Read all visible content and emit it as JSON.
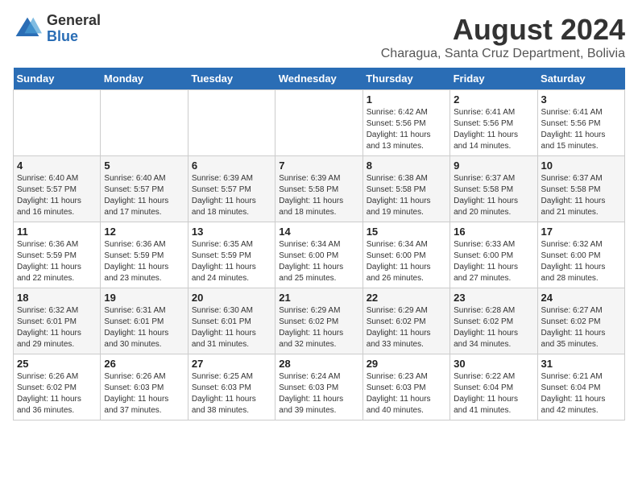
{
  "logo": {
    "general": "General",
    "blue": "Blue"
  },
  "title": "August 2024",
  "subtitle": "Charagua, Santa Cruz Department, Bolivia",
  "days_of_week": [
    "Sunday",
    "Monday",
    "Tuesday",
    "Wednesday",
    "Thursday",
    "Friday",
    "Saturday"
  ],
  "weeks": [
    [
      {
        "day": "",
        "info": ""
      },
      {
        "day": "",
        "info": ""
      },
      {
        "day": "",
        "info": ""
      },
      {
        "day": "",
        "info": ""
      },
      {
        "day": "1",
        "info": "Sunrise: 6:42 AM\nSunset: 5:56 PM\nDaylight: 11 hours\nand 13 minutes."
      },
      {
        "day": "2",
        "info": "Sunrise: 6:41 AM\nSunset: 5:56 PM\nDaylight: 11 hours\nand 14 minutes."
      },
      {
        "day": "3",
        "info": "Sunrise: 6:41 AM\nSunset: 5:56 PM\nDaylight: 11 hours\nand 15 minutes."
      }
    ],
    [
      {
        "day": "4",
        "info": "Sunrise: 6:40 AM\nSunset: 5:57 PM\nDaylight: 11 hours\nand 16 minutes."
      },
      {
        "day": "5",
        "info": "Sunrise: 6:40 AM\nSunset: 5:57 PM\nDaylight: 11 hours\nand 17 minutes."
      },
      {
        "day": "6",
        "info": "Sunrise: 6:39 AM\nSunset: 5:57 PM\nDaylight: 11 hours\nand 18 minutes."
      },
      {
        "day": "7",
        "info": "Sunrise: 6:39 AM\nSunset: 5:58 PM\nDaylight: 11 hours\nand 18 minutes."
      },
      {
        "day": "8",
        "info": "Sunrise: 6:38 AM\nSunset: 5:58 PM\nDaylight: 11 hours\nand 19 minutes."
      },
      {
        "day": "9",
        "info": "Sunrise: 6:37 AM\nSunset: 5:58 PM\nDaylight: 11 hours\nand 20 minutes."
      },
      {
        "day": "10",
        "info": "Sunrise: 6:37 AM\nSunset: 5:58 PM\nDaylight: 11 hours\nand 21 minutes."
      }
    ],
    [
      {
        "day": "11",
        "info": "Sunrise: 6:36 AM\nSunset: 5:59 PM\nDaylight: 11 hours\nand 22 minutes."
      },
      {
        "day": "12",
        "info": "Sunrise: 6:36 AM\nSunset: 5:59 PM\nDaylight: 11 hours\nand 23 minutes."
      },
      {
        "day": "13",
        "info": "Sunrise: 6:35 AM\nSunset: 5:59 PM\nDaylight: 11 hours\nand 24 minutes."
      },
      {
        "day": "14",
        "info": "Sunrise: 6:34 AM\nSunset: 6:00 PM\nDaylight: 11 hours\nand 25 minutes."
      },
      {
        "day": "15",
        "info": "Sunrise: 6:34 AM\nSunset: 6:00 PM\nDaylight: 11 hours\nand 26 minutes."
      },
      {
        "day": "16",
        "info": "Sunrise: 6:33 AM\nSunset: 6:00 PM\nDaylight: 11 hours\nand 27 minutes."
      },
      {
        "day": "17",
        "info": "Sunrise: 6:32 AM\nSunset: 6:00 PM\nDaylight: 11 hours\nand 28 minutes."
      }
    ],
    [
      {
        "day": "18",
        "info": "Sunrise: 6:32 AM\nSunset: 6:01 PM\nDaylight: 11 hours\nand 29 minutes."
      },
      {
        "day": "19",
        "info": "Sunrise: 6:31 AM\nSunset: 6:01 PM\nDaylight: 11 hours\nand 30 minutes."
      },
      {
        "day": "20",
        "info": "Sunrise: 6:30 AM\nSunset: 6:01 PM\nDaylight: 11 hours\nand 31 minutes."
      },
      {
        "day": "21",
        "info": "Sunrise: 6:29 AM\nSunset: 6:02 PM\nDaylight: 11 hours\nand 32 minutes."
      },
      {
        "day": "22",
        "info": "Sunrise: 6:29 AM\nSunset: 6:02 PM\nDaylight: 11 hours\nand 33 minutes."
      },
      {
        "day": "23",
        "info": "Sunrise: 6:28 AM\nSunset: 6:02 PM\nDaylight: 11 hours\nand 34 minutes."
      },
      {
        "day": "24",
        "info": "Sunrise: 6:27 AM\nSunset: 6:02 PM\nDaylight: 11 hours\nand 35 minutes."
      }
    ],
    [
      {
        "day": "25",
        "info": "Sunrise: 6:26 AM\nSunset: 6:02 PM\nDaylight: 11 hours\nand 36 minutes."
      },
      {
        "day": "26",
        "info": "Sunrise: 6:26 AM\nSunset: 6:03 PM\nDaylight: 11 hours\nand 37 minutes."
      },
      {
        "day": "27",
        "info": "Sunrise: 6:25 AM\nSunset: 6:03 PM\nDaylight: 11 hours\nand 38 minutes."
      },
      {
        "day": "28",
        "info": "Sunrise: 6:24 AM\nSunset: 6:03 PM\nDaylight: 11 hours\nand 39 minutes."
      },
      {
        "day": "29",
        "info": "Sunrise: 6:23 AM\nSunset: 6:03 PM\nDaylight: 11 hours\nand 40 minutes."
      },
      {
        "day": "30",
        "info": "Sunrise: 6:22 AM\nSunset: 6:04 PM\nDaylight: 11 hours\nand 41 minutes."
      },
      {
        "day": "31",
        "info": "Sunrise: 6:21 AM\nSunset: 6:04 PM\nDaylight: 11 hours\nand 42 minutes."
      }
    ]
  ]
}
